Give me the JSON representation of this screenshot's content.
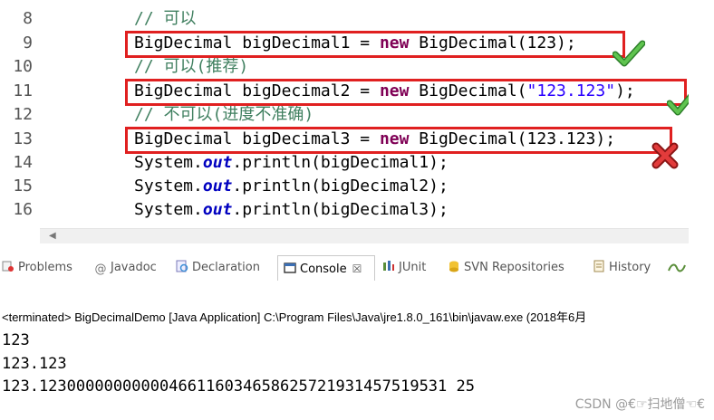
{
  "editor": {
    "lines": [
      {
        "num": "8",
        "kind": "comment",
        "text": "// 可以"
      },
      {
        "num": "9",
        "kind": "code",
        "type": "BigDecimal",
        "var": "bigDecimal1",
        "eq": " = ",
        "kw": "new",
        "ctor": " BigDecimal(",
        "arg": "123",
        "end": ");"
      },
      {
        "num": "10",
        "kind": "comment",
        "text": "// 可以(推荐)"
      },
      {
        "num": "11",
        "kind": "code",
        "type": "BigDecimal",
        "var": "bigDecimal2",
        "eq": " = ",
        "kw": "new",
        "ctor": " BigDecimal(",
        "str": "\"123.123\"",
        "end": ");"
      },
      {
        "num": "12",
        "kind": "comment",
        "text": "// 不可以(进度不准确)"
      },
      {
        "num": "13",
        "kind": "code",
        "type": "BigDecimal",
        "var": "bigDecimal3",
        "eq": " = ",
        "kw": "new",
        "ctor": " BigDecimal(",
        "arg": "123.123",
        "end": ");"
      },
      {
        "num": "14",
        "kind": "print",
        "pre": "System.",
        "field": "out",
        "post": ".println(bigDecimal1);"
      },
      {
        "num": "15",
        "kind": "print",
        "pre": "System.",
        "field": "out",
        "post": ".println(bigDecimal2);"
      },
      {
        "num": "16",
        "kind": "print",
        "pre": "System.",
        "field": "out",
        "post": ".println(bigDecimal3);"
      }
    ]
  },
  "tabs": [
    {
      "label": "Problems",
      "icon": "problems-icon"
    },
    {
      "label": "Javadoc",
      "icon": "at-icon"
    },
    {
      "label": "Declaration",
      "icon": "declaration-icon"
    },
    {
      "label": "Console",
      "icon": "console-icon",
      "active": true,
      "close": "☒"
    },
    {
      "label": "JUnit",
      "icon": "junit-icon"
    },
    {
      "label": "SVN Repositories",
      "icon": "svn-icon"
    },
    {
      "label": "History",
      "icon": "history-icon"
    }
  ],
  "console": {
    "header": "<terminated> BigDecimalDemo [Java Application] C:\\Program Files\\Java\\jre1.8.0_161\\bin\\javaw.exe (2018年6月",
    "output": [
      "123",
      "123.123",
      "123.12300000000000466116034658625721931457519531 25"
    ]
  },
  "watermark": "CSDN @€☞扫地僧☜€",
  "colors": {
    "highlight": "#e02020",
    "check": "#3aa335",
    "cross": "#d62a2a",
    "keyword": "#7f0055",
    "comment": "#3f7f5f",
    "string": "#2a00ff"
  }
}
